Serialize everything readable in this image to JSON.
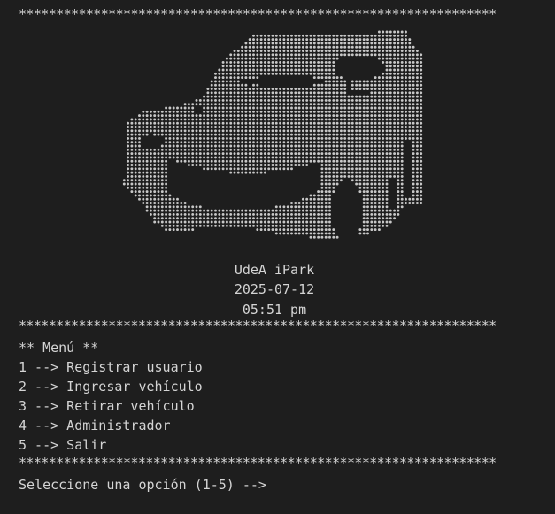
{
  "terminal": {
    "separator": "****************************************************************",
    "app_name": "UdeA iPark",
    "date": "2025-07-12",
    "time": "05:51 pm",
    "menu_title": "** Menú **",
    "menu_items": [
      "1 --> Registrar usuario",
      "2 --> Ingresar vehículo",
      "3 --> Retirar vehículo",
      "4 --> Administrador",
      "5 --> Salir"
    ],
    "prompt": "Seleccione una opción (1-5) -->"
  },
  "colors": {
    "background": "#1e1e1e",
    "text": "#d4d4d4",
    "dots": "#c8c8c8"
  },
  "icons": {
    "ascii_art": "car-dot-art"
  }
}
